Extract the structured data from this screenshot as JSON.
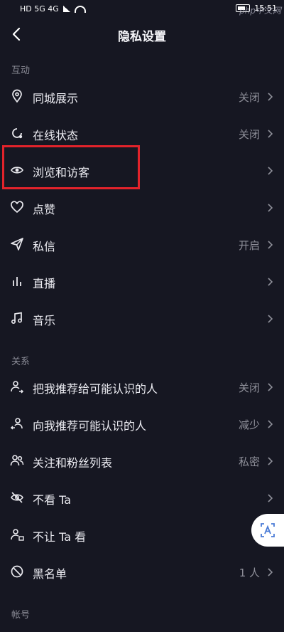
{
  "status": {
    "left": "HD 5G 4G",
    "time": "15:51"
  },
  "header": {
    "title": "隐私设置"
  },
  "sections": {
    "interaction": "互动",
    "relations": "关系",
    "account": "帐号"
  },
  "rows": {
    "city": {
      "label": "同城展示",
      "value": "关闭"
    },
    "online": {
      "label": "在线状态",
      "value": "关闭"
    },
    "browse": {
      "label": "浏览和访客",
      "value": ""
    },
    "like": {
      "label": "点赞",
      "value": ""
    },
    "message": {
      "label": "私信",
      "value": "开启"
    },
    "live": {
      "label": "直播",
      "value": ""
    },
    "music": {
      "label": "音乐",
      "value": ""
    },
    "recommend_me": {
      "label": "把我推荐给可能认识的人",
      "value": "关闭"
    },
    "recommend_to_me": {
      "label": "向我推荐可能认识的人",
      "value": "减少"
    },
    "follow_list": {
      "label": "关注和粉丝列表",
      "value": "私密"
    },
    "not_see": {
      "label": "不看 Ta",
      "value": ""
    },
    "not_let_see": {
      "label": "不让 Ta 看",
      "value": ""
    },
    "blacklist": {
      "label": "黑名单",
      "value": "1 人"
    }
  },
  "watermark": "php中文网"
}
